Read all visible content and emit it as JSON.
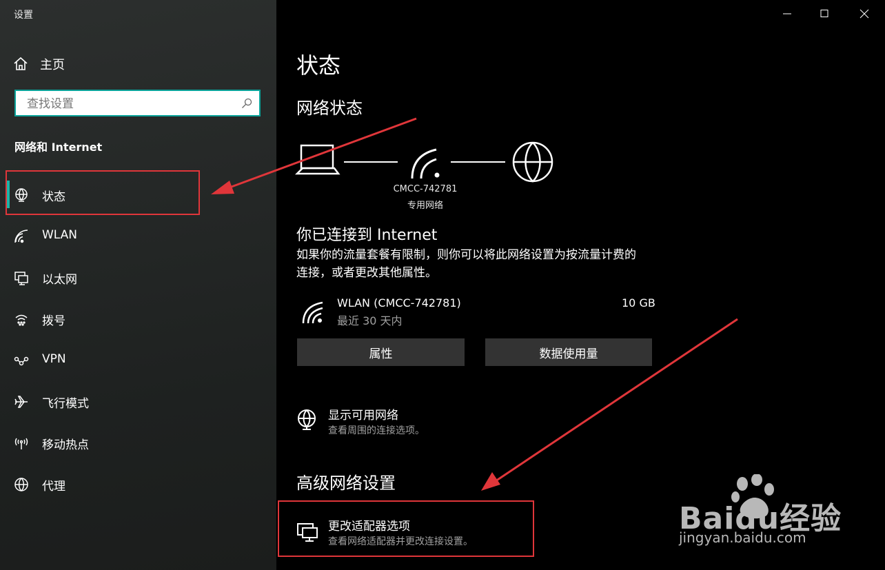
{
  "window": {
    "title": "设置"
  },
  "sidebar": {
    "home_label": "主页",
    "search_placeholder": "查找设置",
    "section_title": "网络和 Internet",
    "items": [
      {
        "label": "状态",
        "icon": "status-globe-icon",
        "selected": true
      },
      {
        "label": "WLAN",
        "icon": "wifi-icon"
      },
      {
        "label": "以太网",
        "icon": "ethernet-icon"
      },
      {
        "label": "拨号",
        "icon": "dialup-icon"
      },
      {
        "label": "VPN",
        "icon": "vpn-icon"
      },
      {
        "label": "飞行模式",
        "icon": "airplane-icon"
      },
      {
        "label": "移动热点",
        "icon": "hotspot-icon"
      },
      {
        "label": "代理",
        "icon": "proxy-globe-icon"
      }
    ]
  },
  "main": {
    "title": "状态",
    "network_status_heading": "网络状态",
    "network_name": "CMCC-742781",
    "network_type": "专用网络",
    "connected_title": "你已连接到 Internet",
    "connected_desc_line1": "如果你的流量套餐有限制，则你可以将此网络设置为按流量计费的",
    "connected_desc_line2": "连接，或者更改其他属性。",
    "connection": {
      "name": "WLAN (CMCC-742781)",
      "period": "最近 30 天内",
      "usage": "10 GB"
    },
    "properties_button": "属性",
    "data_usage_button": "数据使用量",
    "show_networks": {
      "title": "显示可用网络",
      "desc": "查看周围的连接选项。"
    },
    "advanced_heading": "高级网络设置",
    "change_adapter": {
      "title": "更改适配器选项",
      "desc": "查看网络适配器并更改连接设置。"
    }
  },
  "watermark": {
    "brand": "Baidu经验",
    "url": "jingyan.baidu.com"
  },
  "colors": {
    "accent": "#1ab5a8",
    "annotation": "#e0363a",
    "button": "#333333",
    "search_border": "#0aa39a"
  }
}
